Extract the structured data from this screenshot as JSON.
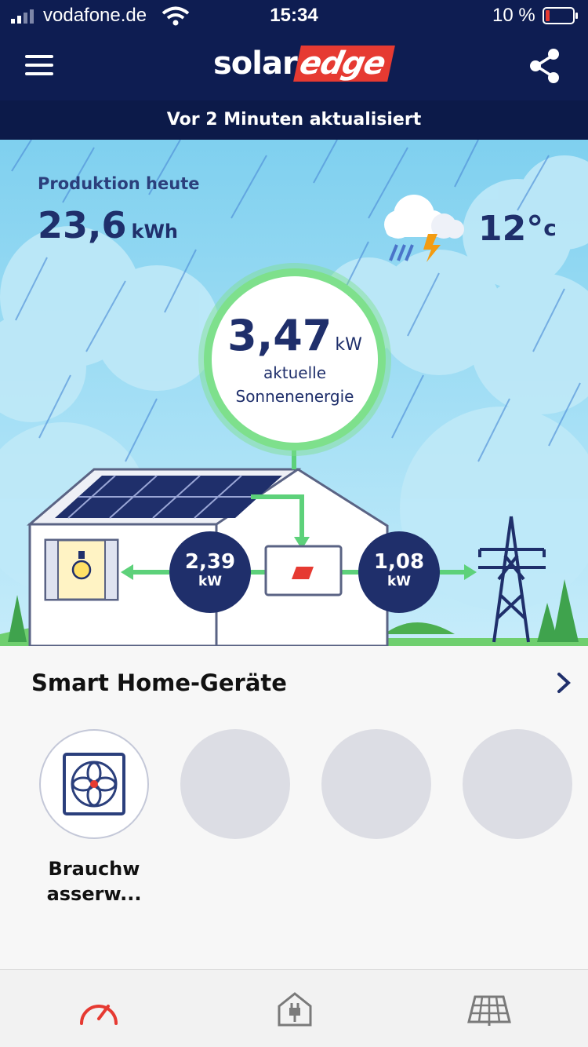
{
  "status_bar": {
    "carrier": "vodafone.de",
    "time": "15:34",
    "battery": "10 %"
  },
  "header": {
    "logo_solar": "solar",
    "logo_edge": "edge"
  },
  "subheader": {
    "text": "Vor 2 Minuten aktualisiert"
  },
  "production": {
    "label": "Produktion heute",
    "value": "23,6",
    "unit": "kWh"
  },
  "weather": {
    "temperature": "12°",
    "unit": "c",
    "icon": "thunderstorm-rain-icon"
  },
  "current": {
    "value": "3,47",
    "unit": "kW",
    "label_line1": "aktuelle",
    "label_line2": "Sonnenenergie"
  },
  "home_consumption": {
    "value": "2,39",
    "unit": "kW"
  },
  "grid_export": {
    "value": "1,08",
    "unit": "kW"
  },
  "smart_home": {
    "title": "Smart Home-Geräte",
    "devices": [
      {
        "label_line1": "Brauchw",
        "label_line2": "asserw...",
        "icon": "fan-icon"
      },
      {
        "label_line1": "",
        "label_line2": ""
      },
      {
        "label_line1": "",
        "label_line2": ""
      },
      {
        "label_line1": "",
        "label_line2": ""
      }
    ]
  },
  "tabs": [
    {
      "icon": "gauge-icon",
      "active": true
    },
    {
      "icon": "house-plug-icon",
      "active": false
    },
    {
      "icon": "solar-panel-icon",
      "active": false
    }
  ],
  "colors": {
    "navy": "#0e1d52",
    "accent_red": "#e63a32",
    "flow_green": "#5dd17a",
    "sky": "#8fd6f1"
  }
}
